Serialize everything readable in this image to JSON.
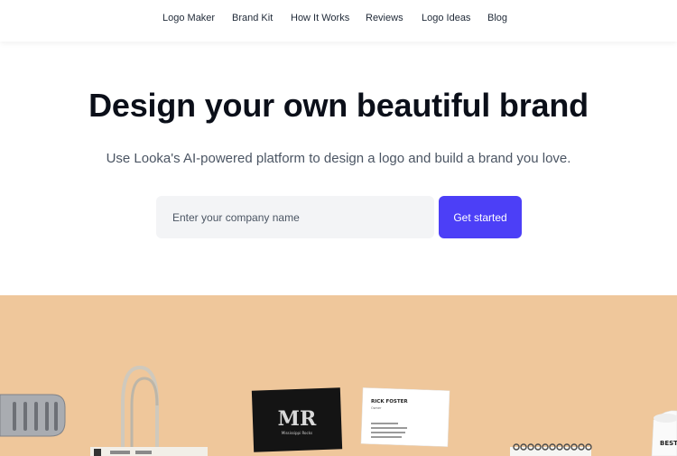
{
  "nav": {
    "items": [
      {
        "label": "Logo Maker"
      },
      {
        "label": "Brand Kit"
      },
      {
        "label": "How It Works"
      },
      {
        "label": "Reviews"
      },
      {
        "label": "Logo Ideas"
      },
      {
        "label": "Blog"
      }
    ]
  },
  "hero": {
    "title": "Design your own beautiful brand",
    "subtitle": "Use Looka's AI-powered platform to design a logo and build a brand you love.",
    "input_placeholder": "Enter your company name",
    "cta_label": "Get started"
  },
  "showcase": {
    "background_color": "#efc79b",
    "logo_monogram": "MR",
    "logo_tagline": "Mississippi Rocks",
    "card_name": "RICK FOSTER",
    "card_role": "Owner",
    "cup_text": "BEST"
  },
  "colors": {
    "accent": "#4c3ff7",
    "input_bg": "#f3f4f6"
  }
}
